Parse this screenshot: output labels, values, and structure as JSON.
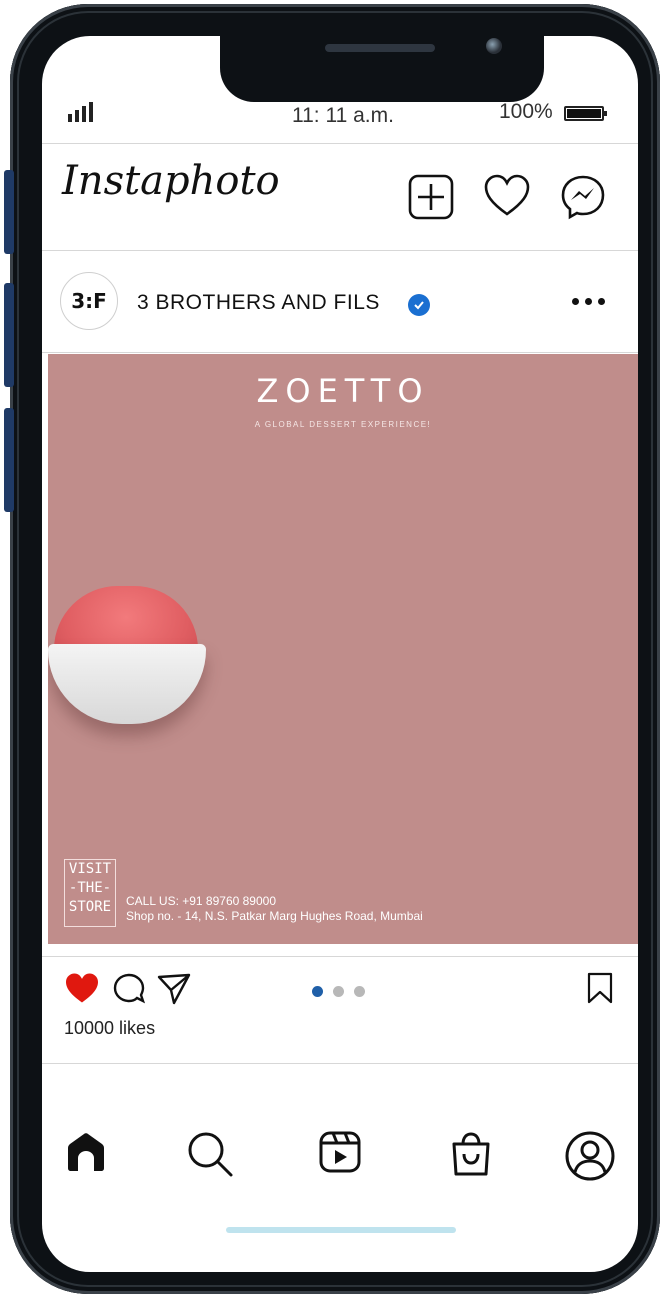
{
  "status_bar": {
    "time": "11: 11 a.m.",
    "battery_percent": "100%"
  },
  "header": {
    "app_name": "Instaphoto"
  },
  "post": {
    "account_name": "3 BROTHERS AND FILS",
    "avatar_logo": "3:F",
    "image": {
      "brand": "ZOETTO",
      "tagline": "A GLOBAL DESSERT EXPERIENCE!",
      "visit_lines": [
        "VISIT",
        "-THE-",
        "STORE"
      ],
      "call": "CALL US: +91 89760 89000",
      "address": "Shop no. - 14, N.S. Patkar Marg Hughes Road, Mumbai"
    },
    "likes": "10000 likes",
    "carousel": {
      "total": 3,
      "active": 1
    }
  },
  "icons": {
    "header": [
      "add-post-icon",
      "heart-icon",
      "messenger-icon"
    ],
    "actions": [
      "heart-filled-icon",
      "comment-icon",
      "share-icon",
      "bookmark-icon"
    ],
    "nav": [
      "home-icon",
      "search-icon",
      "reels-icon",
      "shop-icon",
      "profile-icon"
    ]
  },
  "colors": {
    "like": "#e0180f",
    "verified": "#1a6fd1",
    "post_bg": "#c08d8b"
  }
}
